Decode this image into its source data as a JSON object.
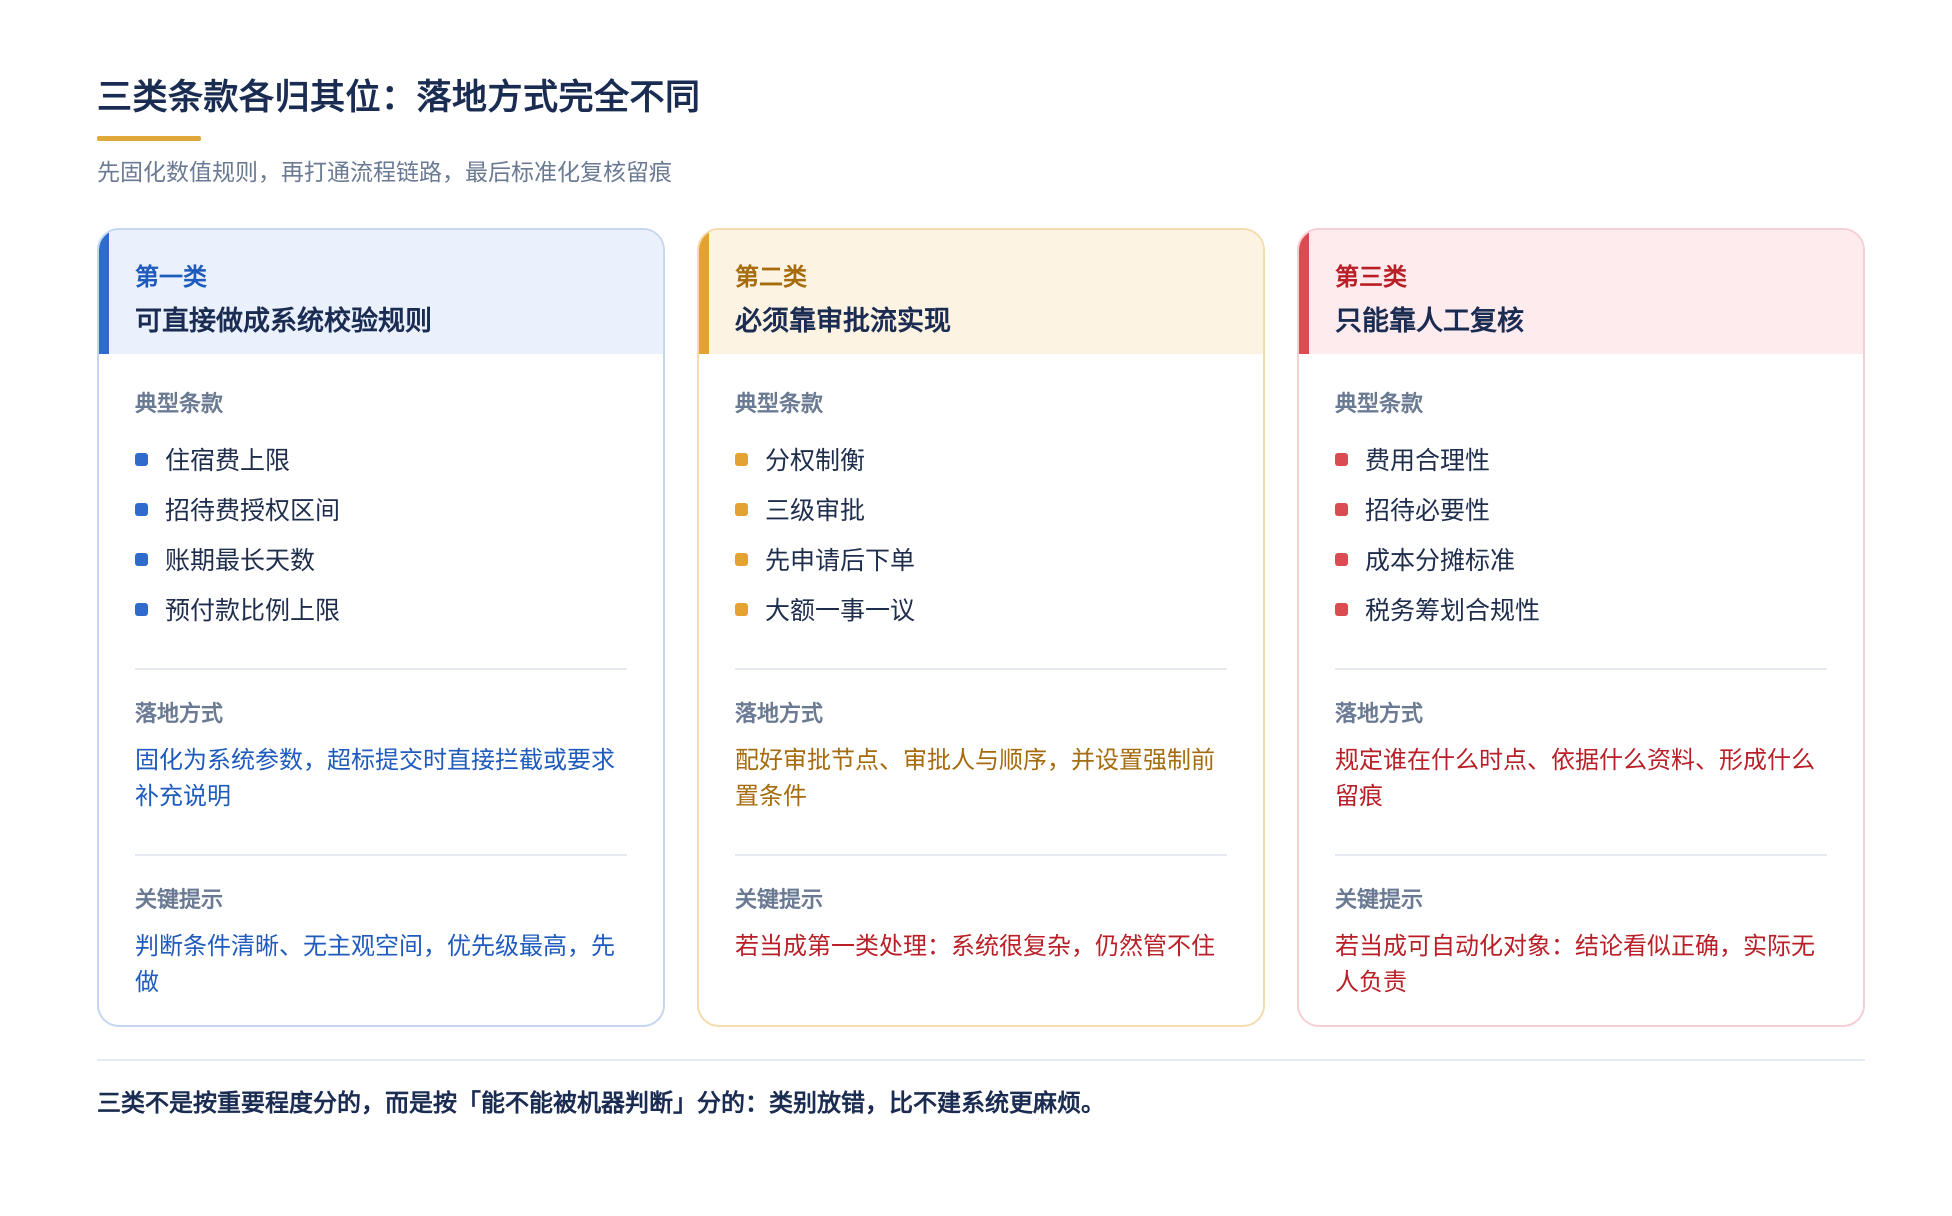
{
  "header": {
    "title": "三类条款各归其位：落地方式完全不同",
    "subtitle": "先固化数值规则，再打通流程链路，最后标准化复核留痕"
  },
  "colors": {
    "title_underline": "#e0a83a",
    "blue_accent": "#2e6bcc",
    "amber_accent": "#e3a232",
    "red_accent": "#da4b52"
  },
  "cards": [
    {
      "kicker": "第一类",
      "title": "可直接做成系统校验规则",
      "typical_label": "典型条款",
      "items": [
        "住宿费上限",
        "招待费授权区间",
        "账期最长天数",
        "预付款比例上限"
      ],
      "method_label": "落地方式",
      "method_text": "固化为系统参数，超标提交时直接拦截或要求补充说明",
      "tip_label": "关键提示",
      "tip_text": "判断条件清晰、无主观空间，优先级最高，先做"
    },
    {
      "kicker": "第二类",
      "title": "必须靠审批流实现",
      "typical_label": "典型条款",
      "items": [
        "分权制衡",
        "三级审批",
        "先申请后下单",
        "大额一事一议"
      ],
      "method_label": "落地方式",
      "method_text": "配好审批节点、审批人与顺序，并设置强制前置条件",
      "tip_label": "关键提示",
      "tip_text": "若当成第一类处理：系统很复杂，仍然管不住"
    },
    {
      "kicker": "第三类",
      "title": "只能靠人工复核",
      "typical_label": "典型条款",
      "items": [
        "费用合理性",
        "招待必要性",
        "成本分摊标准",
        "税务筹划合规性"
      ],
      "method_label": "落地方式",
      "method_text": "规定谁在什么时点、依据什么资料、形成什么留痕",
      "tip_label": "关键提示",
      "tip_text": "若当成可自动化对象：结论看似正确，实际无人负责"
    }
  ],
  "footer": {
    "note": "三类不是按重要程度分的，而是按「能不能被机器判断」分的：类别放错，比不建系统更麻烦。"
  }
}
